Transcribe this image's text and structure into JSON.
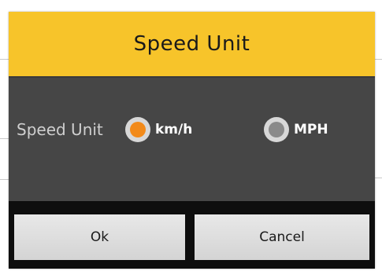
{
  "dialog": {
    "title": "Speed Unit",
    "row_label": "Speed Unit",
    "options": [
      {
        "label": "km/h",
        "selected": true
      },
      {
        "label": "MPH",
        "selected": false
      }
    ],
    "ok_label": "Ok",
    "cancel_label": "Cancel"
  },
  "colors": {
    "title_bar": "#f7c42a",
    "dialog_body": "#464646",
    "button_bar": "#0e0e0e",
    "radio_selected": "#f28a1a",
    "radio_unselected": "#8a8a8a"
  }
}
